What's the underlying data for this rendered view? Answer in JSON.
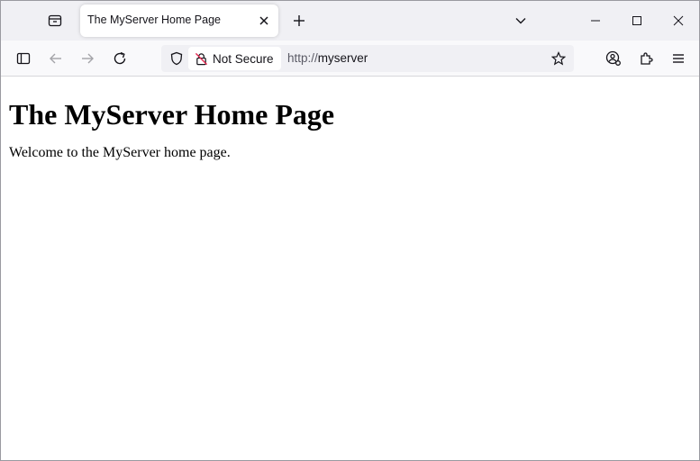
{
  "browser": {
    "tab": {
      "title": "The MyServer Home Page"
    },
    "urlbar": {
      "security_label": "Not Secure",
      "url_scheme": "http://",
      "url_host": "myserver"
    }
  },
  "page": {
    "heading": "The MyServer Home Page",
    "paragraph": "Welcome to the MyServer home page."
  },
  "icons": {
    "tab_strip": [
      "firefox-view-icon",
      "close-icon",
      "plus-icon",
      "chevron-down-icon",
      "minimize-icon",
      "maximize-icon",
      "close-icon"
    ],
    "toolbar": [
      "sidebar-icon",
      "back-arrow-icon",
      "forward-arrow-icon",
      "reload-icon",
      "shield-icon",
      "insecure-lock-icon",
      "star-icon",
      "account-icon",
      "extensions-icon",
      "menu-icon"
    ]
  },
  "colors": {
    "tab_strip_bg": "#f0f0f4",
    "toolbar_bg": "#f9f9fb",
    "urlbar_bg": "#f0f0f4",
    "insecure_accent": "#e22850"
  }
}
